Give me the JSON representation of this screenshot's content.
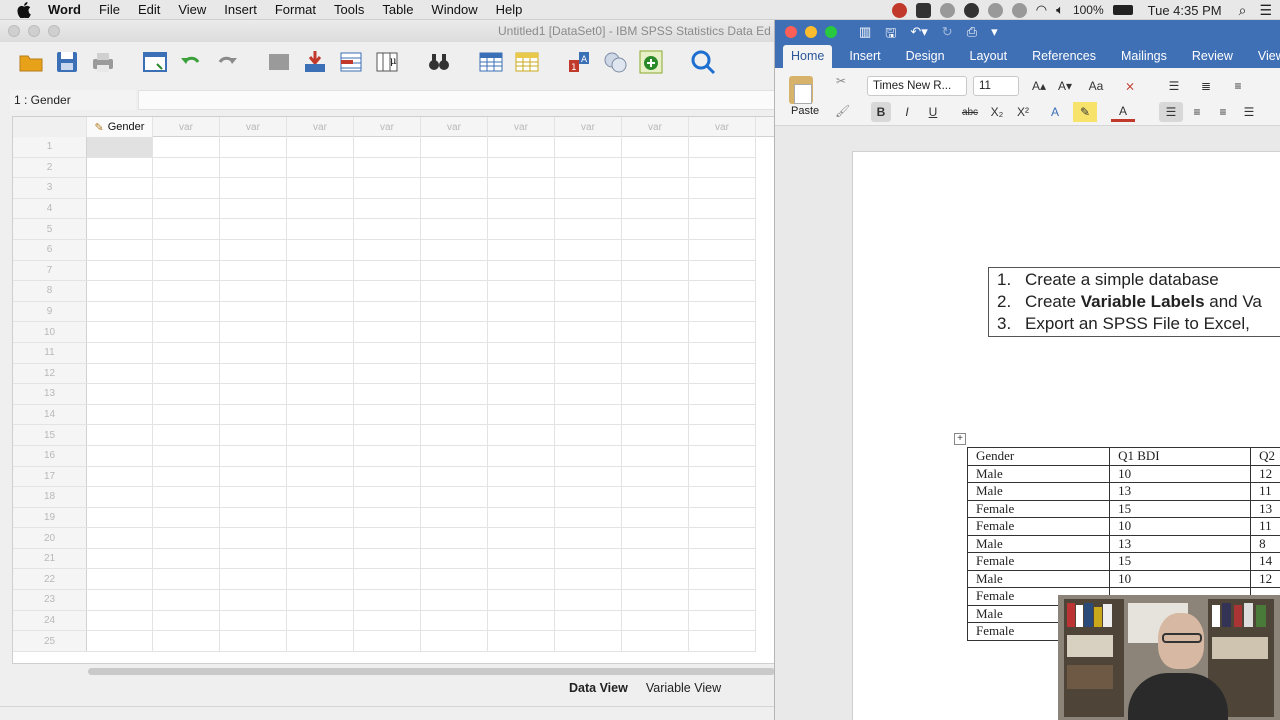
{
  "menubar": {
    "app": "Word",
    "items": [
      "File",
      "Edit",
      "View",
      "Insert",
      "Format",
      "Tools",
      "Table",
      "Window",
      "Help"
    ],
    "battery": "100%",
    "clock": "Tue 4:35 PM"
  },
  "spss": {
    "title": "Untitled1 [DataSet0] - IBM SPSS Statistics Data Ed",
    "cell_ref": "1 : Gender",
    "column_first": "Gender",
    "column_generic": "var",
    "row_numbers": [
      "1",
      "2",
      "3",
      "4",
      "5",
      "6",
      "7",
      "8",
      "9",
      "10",
      "11",
      "12",
      "13",
      "14",
      "15",
      "16",
      "17",
      "18",
      "19",
      "20",
      "21",
      "22",
      "23",
      "24",
      "25"
    ],
    "tabs": {
      "data_view": "Data View",
      "variable_view": "Variable View"
    }
  },
  "word": {
    "tabs": [
      "Home",
      "Insert",
      "Design",
      "Layout",
      "References",
      "Mailings",
      "Review",
      "View"
    ],
    "paste_label": "Paste",
    "font_name": "Times New R...",
    "font_size": "11",
    "list": [
      {
        "num": "1.",
        "pre": "Create a simple database",
        "bold": "",
        "post": ""
      },
      {
        "num": "2.",
        "pre": "Create ",
        "bold": "Variable Labels",
        "post": " and Va"
      },
      {
        "num": "3.",
        "pre": "Export an SPSS File to Excel,",
        "bold": "",
        "post": ""
      }
    ],
    "table": {
      "headers": [
        "Gender",
        "Q1  BDI",
        "Q2"
      ],
      "rows": [
        [
          "Male",
          "10",
          "12"
        ],
        [
          "Male",
          "13",
          "11"
        ],
        [
          "Female",
          "15",
          "13"
        ],
        [
          "Female",
          "10",
          "11"
        ],
        [
          "Male",
          "13",
          "8"
        ],
        [
          "Female",
          "15",
          "14"
        ],
        [
          "Male",
          "10",
          "12"
        ],
        [
          "Female",
          "",
          ""
        ],
        [
          "Male",
          "",
          ""
        ],
        [
          "Female",
          "",
          ""
        ]
      ]
    }
  }
}
